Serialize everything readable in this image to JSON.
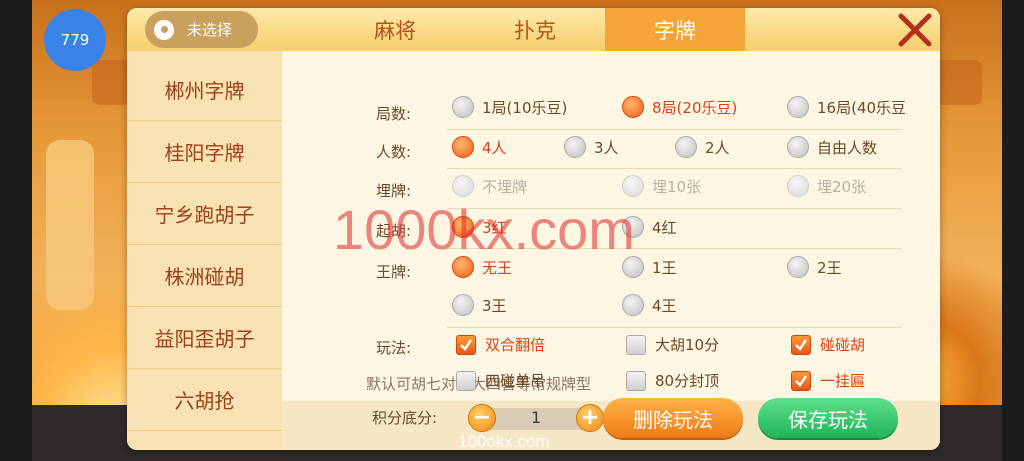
{
  "counter": "779",
  "location": {
    "label": "未选择"
  },
  "tabs": [
    {
      "label": "麻将",
      "active": false
    },
    {
      "label": "扑克",
      "active": false
    },
    {
      "label": "字牌",
      "active": true
    }
  ],
  "sidebar": {
    "items": [
      {
        "label": "郴州字牌"
      },
      {
        "label": "桂阳字牌"
      },
      {
        "label": "宁乡跑胡子"
      },
      {
        "label": "株洲碰胡"
      },
      {
        "label": "益阳歪胡子"
      },
      {
        "label": "六胡抢"
      }
    ]
  },
  "options": {
    "rounds": {
      "label": "局数:",
      "choices": [
        "1局(10乐豆)",
        "8局(20乐豆)",
        "16局(40乐豆"
      ],
      "selected": "8局(20乐豆)"
    },
    "players": {
      "label": "人数:",
      "choices": [
        "4人",
        "3人",
        "2人",
        "自由人数"
      ],
      "selected": "4人"
    },
    "bury": {
      "label": "埋牌:",
      "choices": [
        "不埋牌",
        "埋10张",
        "埋20张"
      ]
    },
    "qihu": {
      "label": "起胡:",
      "choices": [
        "3红",
        "4红"
      ],
      "selected": "3红"
    },
    "wang": {
      "label": "王牌:",
      "choices": [
        "无王",
        "1王",
        "2王",
        "3王",
        "4王"
      ],
      "selected": "无王"
    },
    "play": {
      "label": "玩法:",
      "checks": [
        {
          "label": "双合翻倍",
          "checked": true
        },
        {
          "label": "大胡10分",
          "checked": false
        },
        {
          "label": "碰碰胡",
          "checked": true
        },
        {
          "label": "四碰单吊",
          "checked": false
        },
        {
          "label": "80分封顶",
          "checked": false
        },
        {
          "label": "一挂匾",
          "checked": true
        }
      ],
      "note": "默认可胡七对、大四喜等常规牌型"
    }
  },
  "footer": {
    "score_label": "积分底分:",
    "score_value": "1",
    "delete_label": "删除玩法",
    "save_label": "保存玩法"
  },
  "watermark": {
    "large": "1000kx.com",
    "small": "100okx.com"
  },
  "colors": {
    "accent": "#f5a43a",
    "selected_text": "#d8431c",
    "save": "#1fb45a",
    "delete": "#ef7a14"
  }
}
